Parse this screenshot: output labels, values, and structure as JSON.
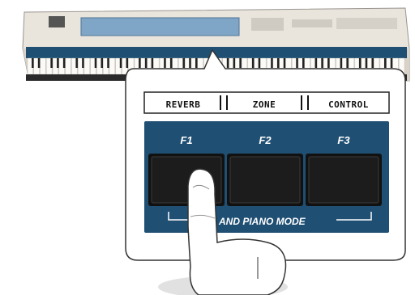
{
  "display": {
    "tabs": [
      "REVERB",
      "ZONE",
      "CONTROL"
    ]
  },
  "function_keys": {
    "labels": [
      "F1",
      "F2",
      "F3"
    ]
  },
  "mode_label": "AND PIANO MODE",
  "colors": {
    "panel_blue": "#1f4f73",
    "button_black": "#1c1c1c",
    "piano_body": "#e9e4dc"
  }
}
